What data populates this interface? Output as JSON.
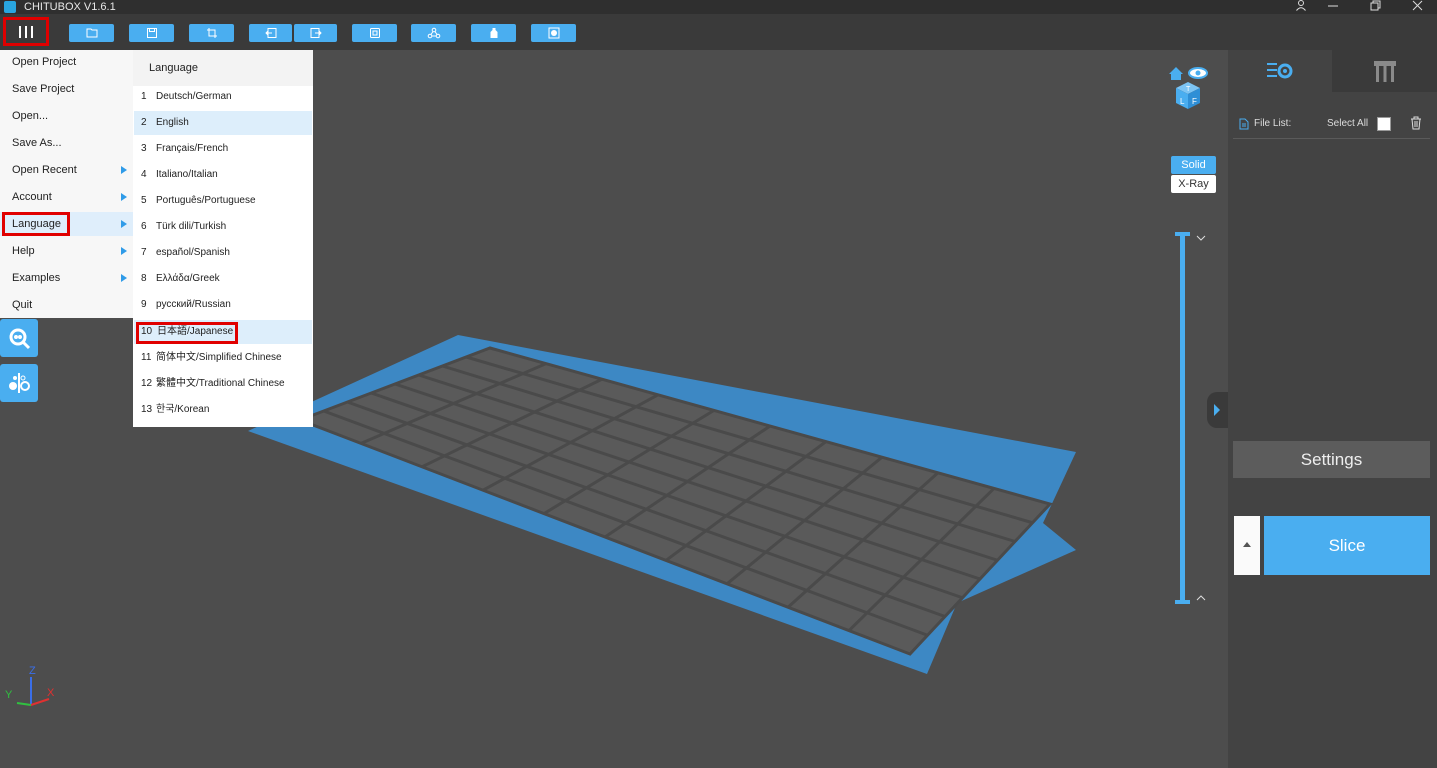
{
  "app": {
    "title": "CHITUBOX V1.6.1"
  },
  "main_menu": {
    "items": [
      {
        "label": "Open Project",
        "submenu": false
      },
      {
        "label": "Save Project",
        "submenu": false
      },
      {
        "label": "Open...",
        "submenu": false
      },
      {
        "label": "Save As...",
        "submenu": false
      },
      {
        "label": "Open Recent",
        "submenu": true
      },
      {
        "label": "Account",
        "submenu": true
      },
      {
        "label": "Language",
        "submenu": true
      },
      {
        "label": "Help",
        "submenu": true
      },
      {
        "label": "Examples",
        "submenu": true
      },
      {
        "label": "Quit",
        "submenu": false
      }
    ]
  },
  "language_menu": {
    "heading": "Language",
    "items": [
      {
        "num": "1",
        "label": "Deutsch/German"
      },
      {
        "num": "2",
        "label": "English"
      },
      {
        "num": "3",
        "label": "Français/French"
      },
      {
        "num": "4",
        "label": "Italiano/Italian"
      },
      {
        "num": "5",
        "label": "Português/Portuguese"
      },
      {
        "num": "6",
        "label": "Türk dili/Turkish"
      },
      {
        "num": "7",
        "label": "español/Spanish"
      },
      {
        "num": "8",
        "label": "Ελλάδα/Greek"
      },
      {
        "num": "9",
        "label": "русский/Russian"
      },
      {
        "num": "10",
        "label": "日本語/Japanese"
      },
      {
        "num": "11",
        "label": "简体中文/Simplified Chinese"
      },
      {
        "num": "12",
        "label": "繁體中文/Traditional Chinese"
      },
      {
        "num": "13",
        "label": "한국/Korean"
      }
    ]
  },
  "view": {
    "solid_label": "Solid",
    "xray_label": "X-Ray"
  },
  "axes": {
    "x": "X",
    "y": "Y",
    "z": "Z"
  },
  "file_panel": {
    "file_list_label": "File List:",
    "select_all_label": "Select All"
  },
  "actions": {
    "settings_label": "Settings",
    "slice_label": "Slice"
  },
  "colors": {
    "accent": "#4aaef0",
    "highlight": "#e00000",
    "plate_border": "#3d88c4"
  }
}
